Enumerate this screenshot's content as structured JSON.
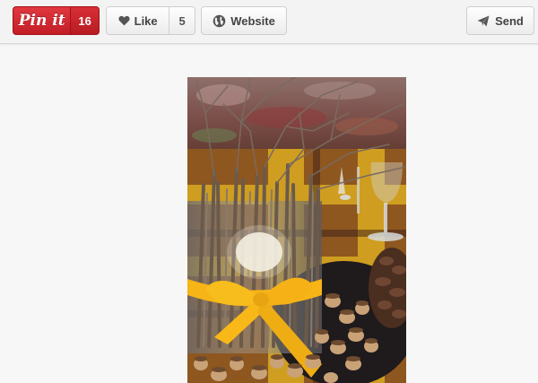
{
  "toolbar": {
    "pin_it": {
      "label": "Pin it",
      "count": "16"
    },
    "like": {
      "label": "Like",
      "count": "5",
      "icon": "heart-icon"
    },
    "website": {
      "label": "Website",
      "icon": "globe-icon"
    },
    "send": {
      "label": "Send",
      "icon": "paper-plane-icon"
    }
  },
  "colors": {
    "pin_red": "#cb2027",
    "toolbar_bg": "#f3f3f3",
    "page_bg": "#f7f7f7",
    "ribbon_yellow": "#f6b417"
  }
}
